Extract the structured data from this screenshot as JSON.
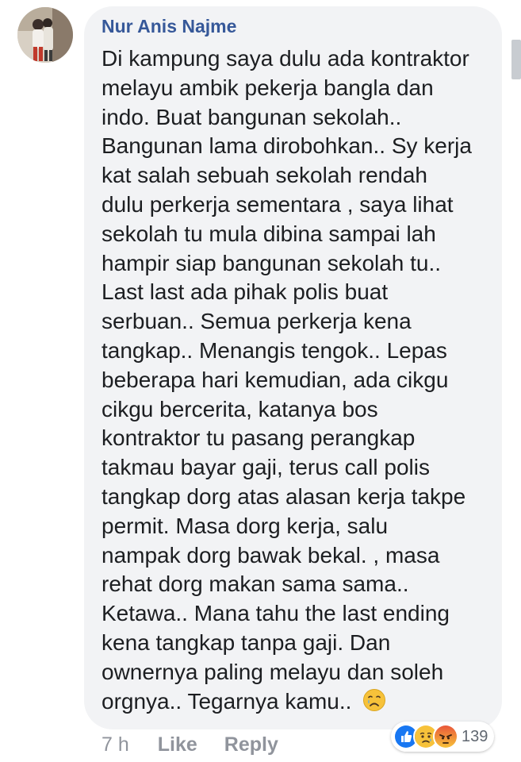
{
  "comment": {
    "author": "Nur Anis Najme",
    "lines": [
      "Di kampung saya dulu ada kontraktor",
      "melayu ambik pekerja bangla dan",
      "indo. Buat bangunan sekolah..",
      "Bangunan lama dirobohkan.. Sy kerja",
      "kat salah sebuah sekolah rendah",
      "dulu perkerja sementara , saya lihat",
      "sekolah tu mula dibina sampai lah",
      "hampir siap bangunan sekolah tu..",
      "Last last ada pihak polis buat",
      "serbuan.. Semua perkerja kena",
      "tangkap..  Menangis tengok.. Lepas",
      "beberapa hari kemudian, ada cikgu",
      "cikgu bercerita, katanya bos",
      "kontraktor tu pasang perangkap",
      "takmau bayar gaji, terus call polis",
      "tangkap dorg atas alasan kerja takpe",
      "permit. Masa dorg kerja,  salu",
      "nampak dorg bawak  bekal. , masa",
      "rehat dorg makan sama sama..",
      "Ketawa..  Mana tahu the last ending",
      "kena tangkap tanpa gaji. Dan",
      "ownernya paling melayu dan soleh",
      "orgnya.. Tegarnya kamu.."
    ],
    "trailing_emoji": "crying-face-icon"
  },
  "actions": {
    "time": "7 h",
    "like_label": "Like",
    "reply_label": "Reply"
  },
  "reactions": {
    "icons": [
      "like-reaction-icon",
      "sad-reaction-icon",
      "angry-reaction-icon"
    ],
    "count": "139"
  },
  "colors": {
    "author": "#365899",
    "text": "#1c1e21",
    "bubble": "#f2f3f5",
    "meta": "#90949c",
    "like_blue": "#1877f2",
    "emoji_yellow": "#f7c23a",
    "angry_red": "#e9573a"
  }
}
